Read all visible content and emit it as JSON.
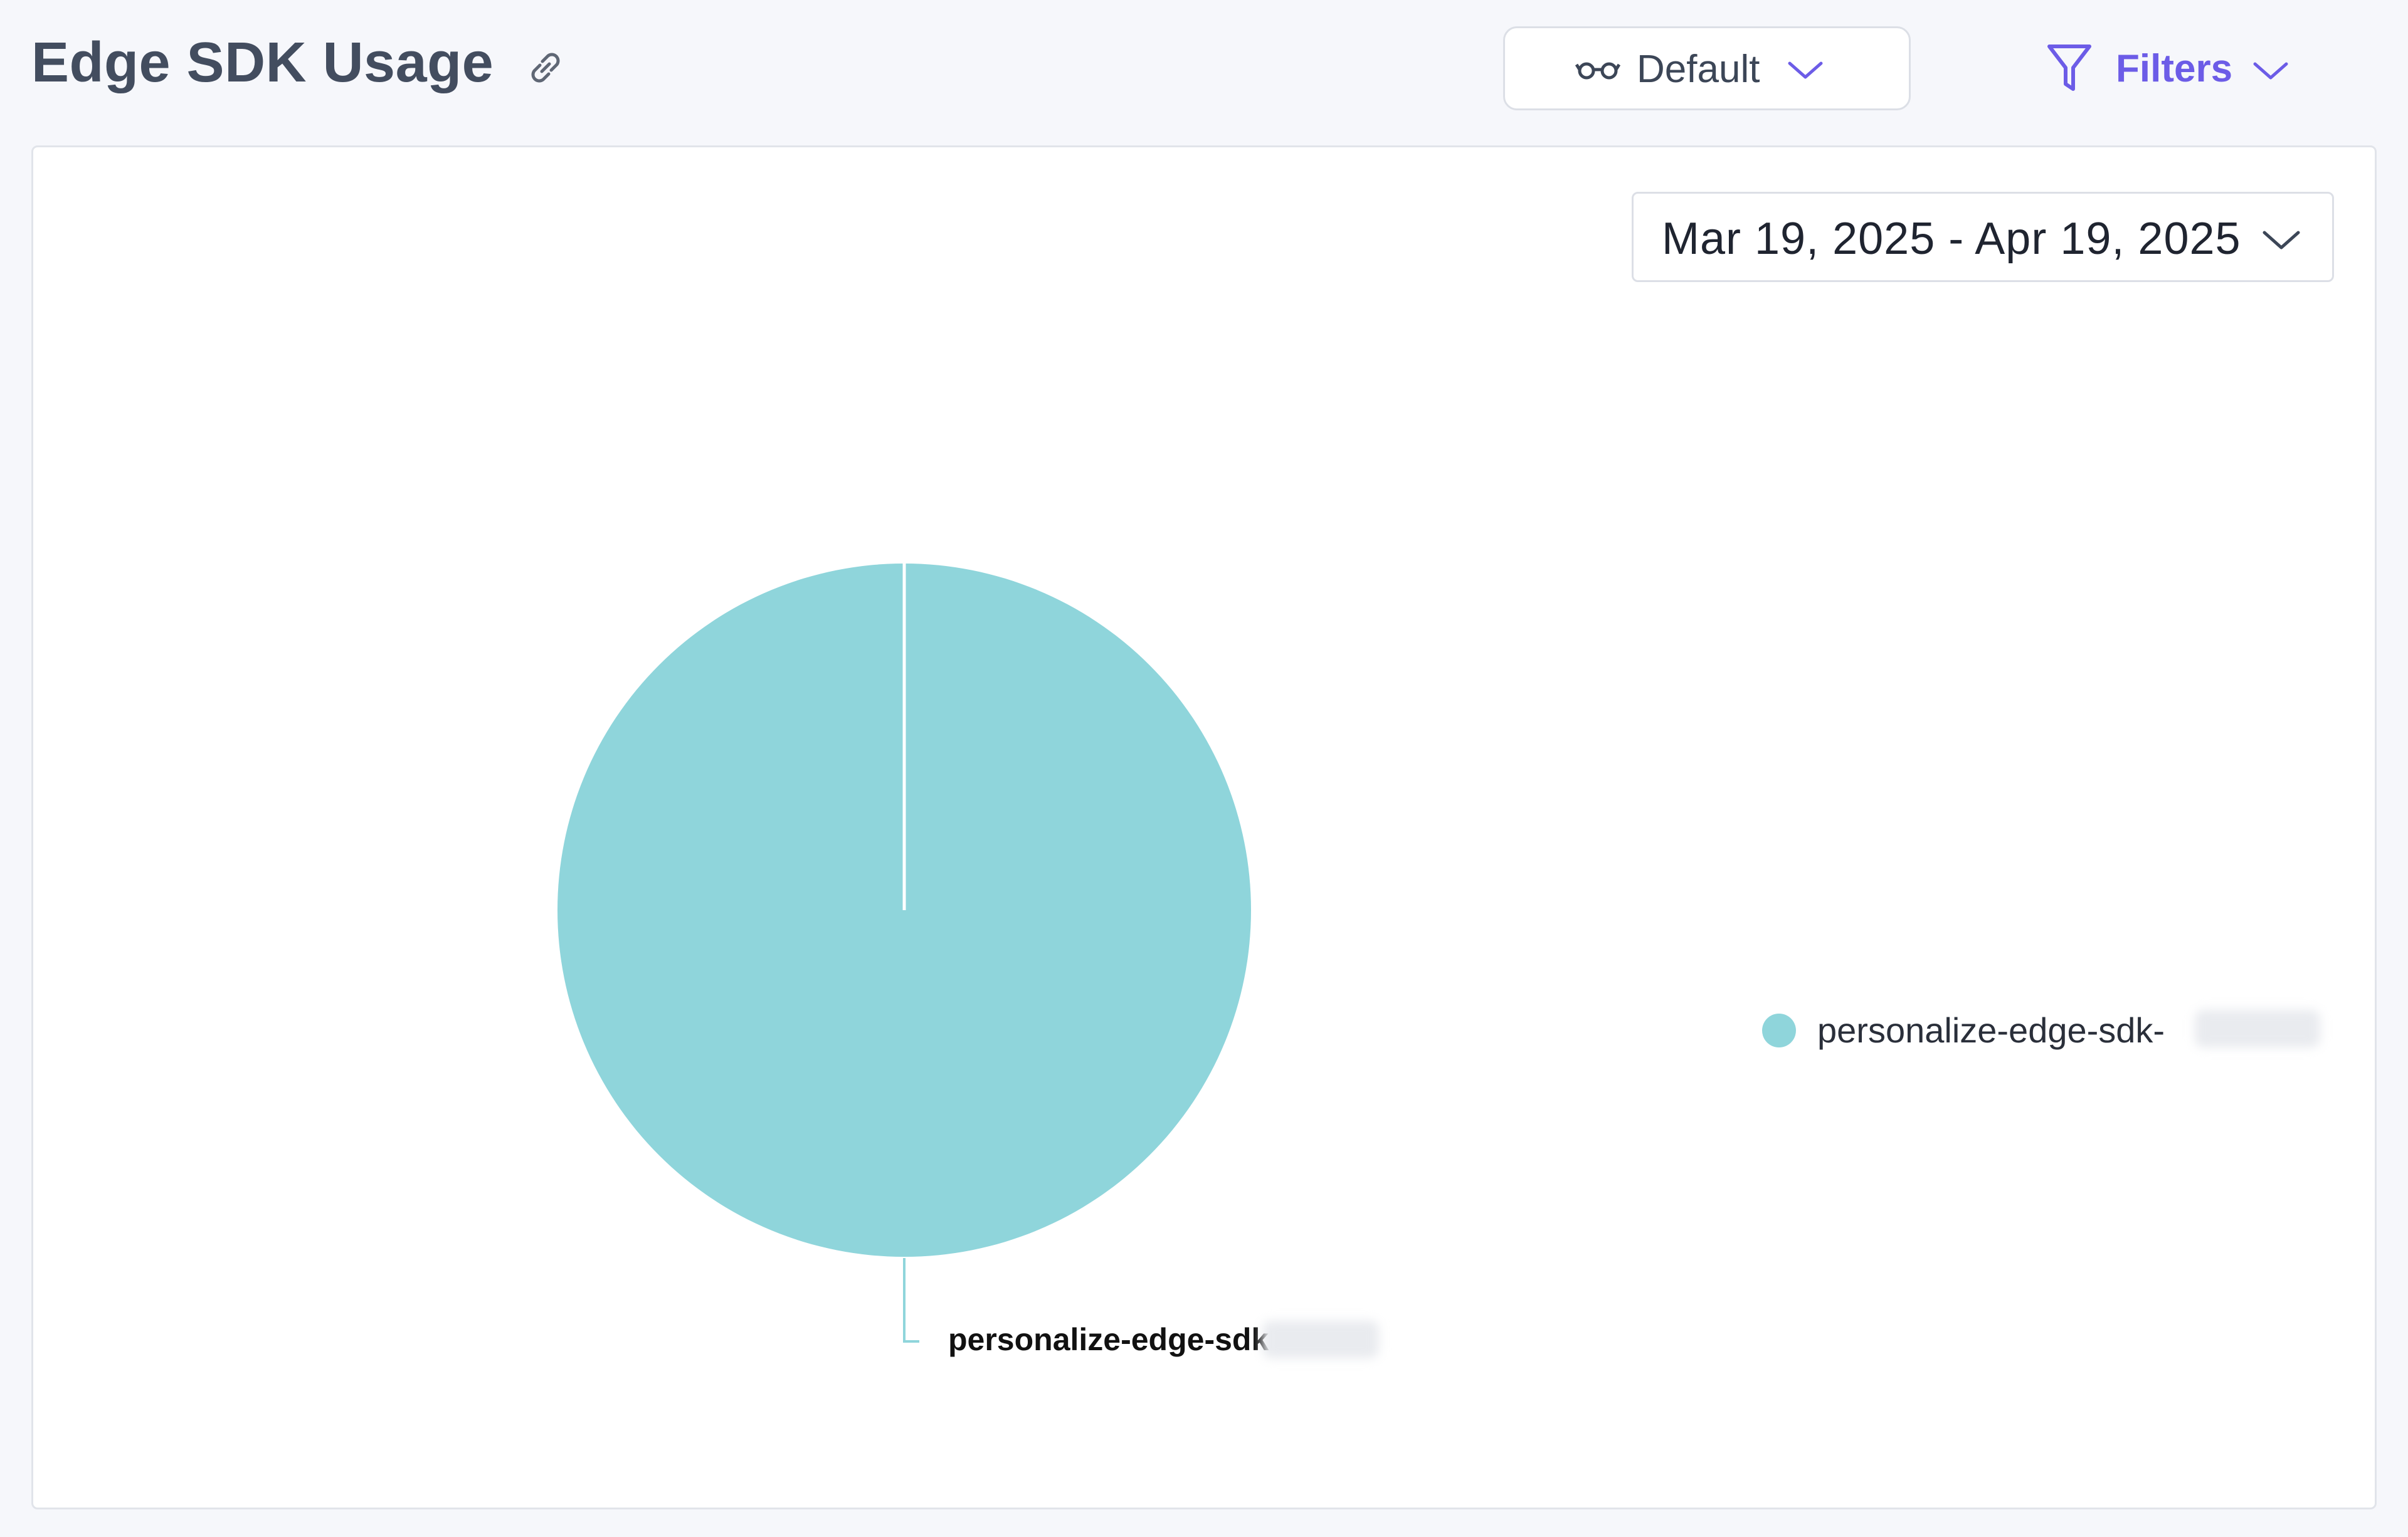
{
  "header": {
    "title": "Edge SDK Usage",
    "view_label": "Default",
    "filters_label": "Filters"
  },
  "icons": {
    "link": "link-icon",
    "view": "glasses-icon",
    "filter": "funnel-icon",
    "chevron": "chevron-down-icon"
  },
  "colors": {
    "accent": "#6c5ce7",
    "slice": "#8fd5db",
    "title": "#434d5f"
  },
  "date_range": {
    "label": "Mar 19, 2025 - Apr 19, 2025"
  },
  "legend": {
    "items": [
      {
        "label": "personalize-edge-sdk-"
      }
    ]
  },
  "chart_data": {
    "type": "pie",
    "title": "",
    "legend_position": "right",
    "slices": [
      {
        "label": "personalize-edge-sdk",
        "value": 100,
        "color": "#8fd5db"
      }
    ]
  }
}
